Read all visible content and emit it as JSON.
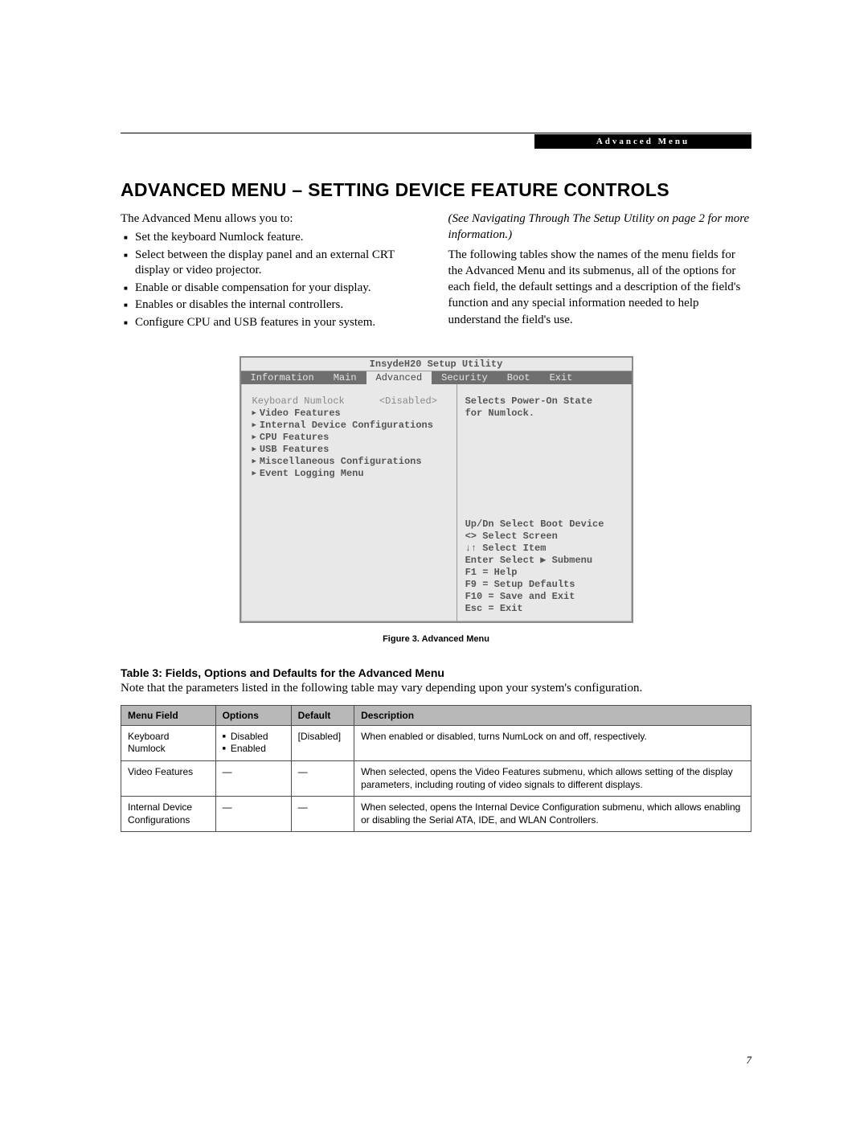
{
  "header": {
    "badge": "Advanced Menu"
  },
  "title": "ADVANCED MENU – SETTING DEVICE FEATURE CONTROLS",
  "left_intro": "The Advanced Menu allows you to:",
  "bullets": [
    "Set the keyboard Numlock feature.",
    "Select between the display panel and an external CRT display or video projector.",
    "Enable or disable compensation for your display.",
    "Enables or disables the internal controllers.",
    "Configure CPU and USB features in your system."
  ],
  "right_italic": "(See Navigating Through The Setup Utility on page 2 for more information.)",
  "right_para": "The following tables show the names of the menu fields for the Advanced Menu and its submenus, all of the options for each field, the default settings and a description of the field's function and any special information needed to help understand the field's use.",
  "bios": {
    "title": "InsydeH20 Setup Utility",
    "tabs": [
      "Information",
      "Main",
      "Advanced",
      "Security",
      "Boot",
      "Exit"
    ],
    "active_tab": "Advanced",
    "first_row_label": "Keyboard Numlock",
    "first_row_value": "<Disabled>",
    "items": [
      "Video Features",
      "Internal Device Configurations",
      "CPU Features",
      "USB Features",
      "Miscellaneous Configurations",
      "Event Logging Menu"
    ],
    "help_top_1": "Selects Power-On State",
    "help_top_2": "for Numlock.",
    "keys": [
      "Up/Dn Select Boot Device",
      "<>    Select Screen",
      "↓↑    Select Item",
      "Enter Select ▶ Submenu",
      "F1  = Help",
      "F9  = Setup Defaults",
      "F10 = Save and Exit",
      "Esc = Exit"
    ]
  },
  "figure_caption": "Figure 3.  Advanced Menu",
  "table_title": "Table 3: Fields, Options and Defaults for the Advanced Menu",
  "table_note": "Note that the parameters listed in the following table may vary depending upon your system's configuration.",
  "table": {
    "headers": [
      "Menu Field",
      "Options",
      "Default",
      "Description"
    ],
    "rows": [
      {
        "field": "Keyboard Numlock",
        "options": [
          "Disabled",
          "Enabled"
        ],
        "default": "[Disabled]",
        "desc": "When enabled or disabled, turns NumLock on and off, respectively."
      },
      {
        "field": "Video Features",
        "options_dash": "—",
        "default": "—",
        "desc": "When selected, opens the Video Features submenu, which allows setting of the display parameters, including routing of video signals to different displays."
      },
      {
        "field": "Internal Device Configurations",
        "options_dash": "—",
        "default": "—",
        "desc": "When selected, opens the Internal Device Configuration submenu, which allows enabling or disabling the Serial ATA, IDE, and WLAN Controllers."
      }
    ]
  },
  "page_number": "7"
}
